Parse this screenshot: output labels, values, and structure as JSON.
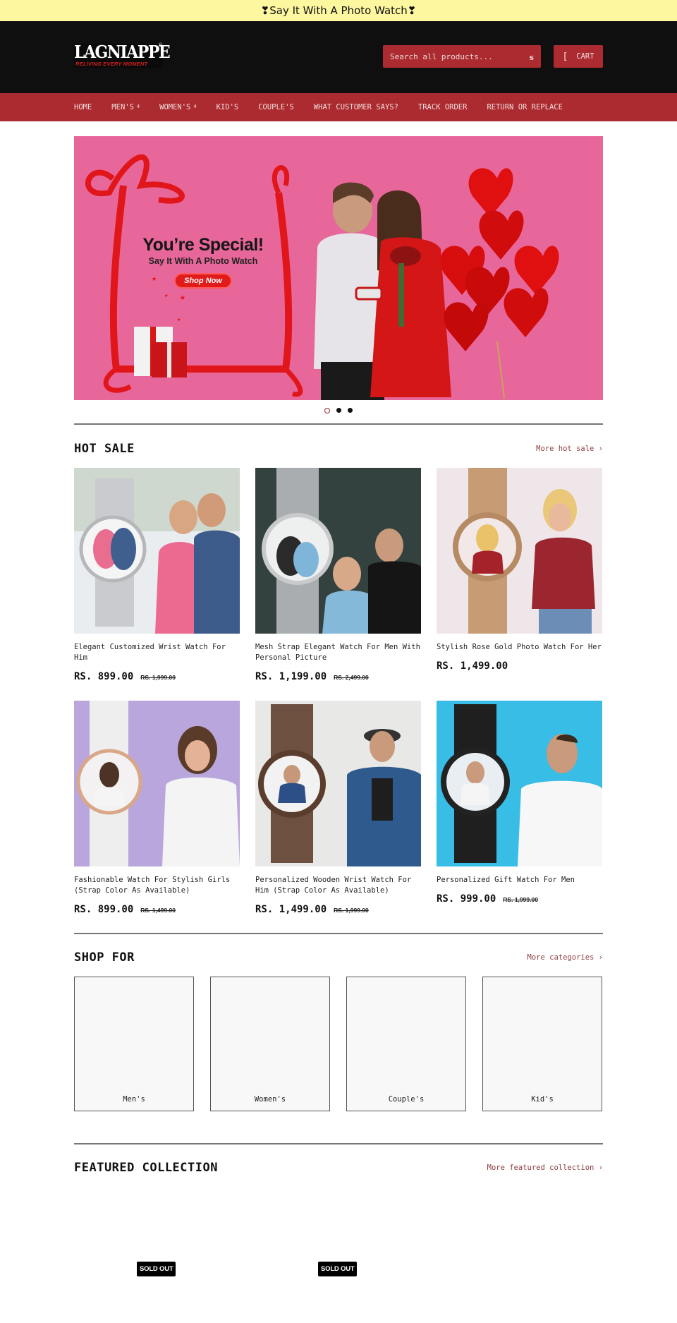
{
  "announcement": {
    "text": "❣Say It With A Photo Watch❣"
  },
  "header": {
    "logo": {
      "main": "LAGNIAPPE",
      "registered": "®",
      "tagline": "RELIVING EVERY MOMENT"
    },
    "search": {
      "placeholder": "Search all products...",
      "icon": "search-icon",
      "icon_glyph": "s"
    },
    "cart": {
      "icon_glyph": "[",
      "label": "CART"
    }
  },
  "nav": {
    "items": [
      {
        "label": "HOME",
        "has_dropdown": false
      },
      {
        "label": "MEN'S",
        "has_dropdown": true,
        "caret": "4"
      },
      {
        "label": "WOMEN'S",
        "has_dropdown": true,
        "caret": "4"
      },
      {
        "label": "KID'S",
        "has_dropdown": false
      },
      {
        "label": "COUPLE'S",
        "has_dropdown": false
      },
      {
        "label": "WHAT CUSTOMER SAYS?",
        "has_dropdown": false
      },
      {
        "label": "TRACK ORDER",
        "has_dropdown": false
      },
      {
        "label": "RETURN OR REPLACE",
        "has_dropdown": false
      }
    ]
  },
  "hero": {
    "title": "You’re Special!",
    "subtitle": "Say It With A Photo Watch",
    "button_label": "Shop Now",
    "slides_count": 3,
    "active_slide": 1
  },
  "hot_sale": {
    "title": "HOT SALE",
    "more_link": "More hot sale ›",
    "products": [
      {
        "name": "Elegant Customized Wrist Watch For Him",
        "price": "RS. 899.00",
        "compare_price": "RS. 1,999.00",
        "bg": "#e9edf0"
      },
      {
        "name": "Mesh Strap Elegant Watch For Men With Personal Picture",
        "price": "RS. 1,199.00",
        "compare_price": "RS. 2,499.00",
        "bg": "#33413f"
      },
      {
        "name": "Stylish Rose Gold Photo Watch For Her",
        "price": "RS. 1,499.00",
        "compare_price": "",
        "bg": "#efe6ea"
      },
      {
        "name": "Fashionable Watch For Stylish Girls (Strap Color As Available)",
        "price": "RS. 899.00",
        "compare_price": "RS. 1,499.00",
        "bg": "#b9a6dc"
      },
      {
        "name": "Personalized Wooden Wrist Watch For Him (Strap Color As Available)",
        "price": "RS. 1,499.00",
        "compare_price": "RS. 1,999.00",
        "bg": "#e8e8e6"
      },
      {
        "name": "Personalized Gift Watch For Men",
        "price": "RS. 999.00",
        "compare_price": "RS. 1,999.00",
        "bg": "#38bde6"
      }
    ]
  },
  "shop_for": {
    "title": "SHOP FOR",
    "more_link": "More categories ›",
    "categories": [
      {
        "label": "Men's"
      },
      {
        "label": "Women's"
      },
      {
        "label": "Couple's"
      },
      {
        "label": "Kid's"
      }
    ]
  },
  "featured": {
    "title": "FEATURED COLLECTION",
    "more_link": "More featured collection ›",
    "badges": [
      {
        "label": "SOLD OUT"
      },
      {
        "label": "SOLD OUT"
      }
    ]
  },
  "colors": {
    "announcement_bg": "#fdf7a0",
    "header_bg": "#0f0f0f",
    "accent": "#ab2b30",
    "hero_bg": "#e8679a",
    "link": "#8f3c40"
  }
}
